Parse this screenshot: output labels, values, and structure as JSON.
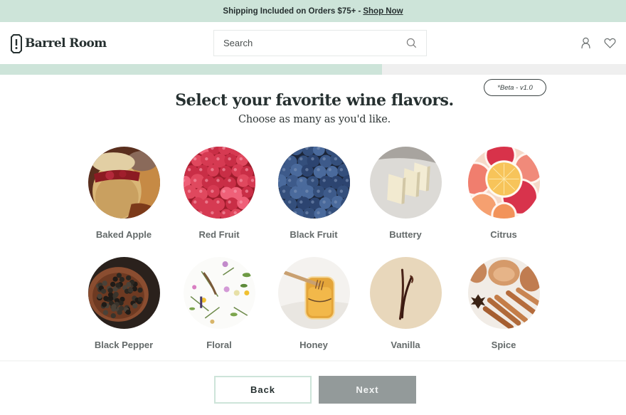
{
  "promo": {
    "text": "Shipping Included on Orders $75+ -",
    "link_label": "Shop Now"
  },
  "header": {
    "logo_text": "Barrel Room",
    "search": {
      "placeholder": "Search",
      "value": "",
      "icon": "search-icon"
    },
    "icons": [
      "account-icon",
      "wishlist-heart-icon"
    ]
  },
  "progress": {
    "percent": 61
  },
  "badge": {
    "label": "*Beta - v1.0"
  },
  "main": {
    "title": "Select your favorite wine flavors.",
    "subtitle": "Choose as many as you'd like.",
    "flavors": [
      {
        "label": "Baked Apple"
      },
      {
        "label": "Red Fruit"
      },
      {
        "label": "Black Fruit"
      },
      {
        "label": "Buttery"
      },
      {
        "label": "Citrus"
      },
      {
        "label": "Black Pepper"
      },
      {
        "label": "Floral"
      },
      {
        "label": "Honey"
      },
      {
        "label": "Vanilla"
      },
      {
        "label": "Spice"
      }
    ]
  },
  "footer": {
    "back_label": "Back",
    "next_label": "Next"
  },
  "colors": {
    "brand_mint": "#cde4d9",
    "text_dark": "#263030",
    "next_disabled": "#939a9a",
    "progress_track": "#efefef"
  }
}
